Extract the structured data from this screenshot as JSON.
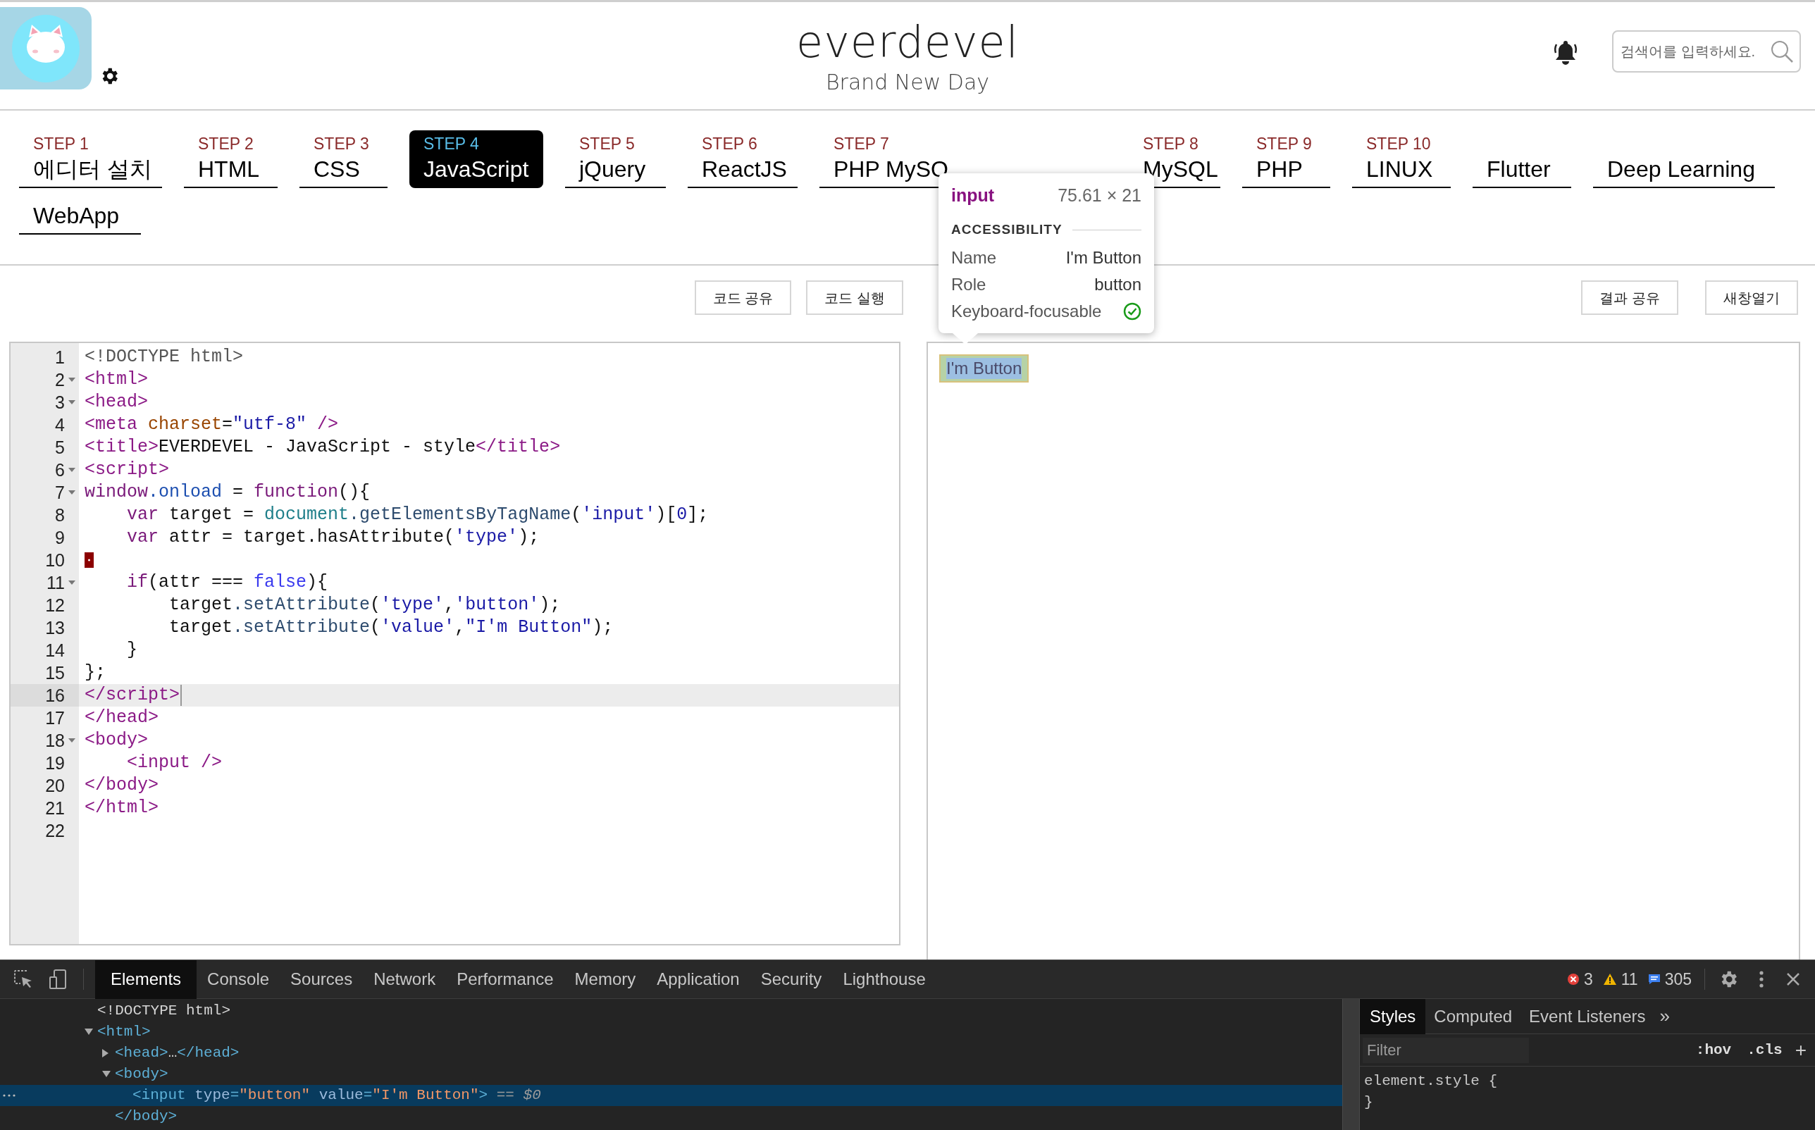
{
  "header": {
    "title": "everdevel",
    "subtitle": "Brand New Day",
    "search": {
      "placeholder": "검색어를 입력하세요."
    }
  },
  "nav": {
    "rows": [
      [
        {
          "step": "STEP 1",
          "label": "에디터 설치",
          "selected": false
        },
        {
          "step": "STEP 2",
          "label": "HTML",
          "selected": false
        },
        {
          "step": "STEP 3",
          "label": "CSS",
          "selected": false
        },
        {
          "step": "STEP 4",
          "label": "JavaScript",
          "selected": true
        },
        {
          "step": "STEP 5",
          "label": "jQuery",
          "selected": false
        },
        {
          "step": "STEP 6",
          "label": "ReactJS",
          "selected": false
        },
        {
          "step": "STEP 7",
          "label": "PHP MySQ",
          "selected": false
        },
        {
          "step": "STEP 8",
          "label": "MySQL",
          "selected": false
        },
        {
          "step": "STEP 9",
          "label": "PHP",
          "selected": false
        },
        {
          "step": "STEP 10",
          "label": "LINUX",
          "selected": false
        },
        {
          "label": "Flutter",
          "selected": false
        },
        {
          "label": "Deep Learning",
          "selected": false
        }
      ],
      [
        {
          "label": "WebApp",
          "selected": false
        }
      ]
    ]
  },
  "editor_buttons": [
    "코드 공유",
    "코드 실행"
  ],
  "result_buttons": [
    "결과 공유",
    "새창열기"
  ],
  "code_lines": [
    {
      "number": "1",
      "fold": false,
      "marked": false,
      "current": false,
      "tokens": [
        {
          "kind": "meta",
          "text": "<!DOCTYPE html>"
        }
      ]
    },
    {
      "number": "2",
      "fold": true,
      "marked": false,
      "current": false,
      "tokens": [
        {
          "kind": "tag",
          "text": "<html>"
        }
      ]
    },
    {
      "number": "3",
      "fold": true,
      "marked": false,
      "current": false,
      "tokens": [
        {
          "kind": "tag",
          "text": "<head>"
        }
      ]
    },
    {
      "number": "4",
      "fold": false,
      "marked": false,
      "current": false,
      "tokens": [
        {
          "kind": "tag",
          "text": "<meta "
        },
        {
          "kind": "attr",
          "text": "charset"
        },
        {
          "kind": "plain",
          "text": "="
        },
        {
          "kind": "string",
          "text": "\"utf-8\""
        },
        {
          "kind": "tag",
          "text": " />"
        }
      ]
    },
    {
      "number": "5",
      "fold": false,
      "marked": false,
      "current": false,
      "tokens": [
        {
          "kind": "tag",
          "text": "<title>"
        },
        {
          "kind": "plain",
          "text": "EVERDEVEL - JavaScript - style"
        },
        {
          "kind": "tag",
          "text": "</title>"
        }
      ]
    },
    {
      "number": "6",
      "fold": true,
      "marked": false,
      "current": false,
      "tokens": [
        {
          "kind": "tag",
          "text": "<script>"
        }
      ]
    },
    {
      "number": "7",
      "fold": true,
      "marked": false,
      "current": false,
      "tokens": [
        {
          "kind": "keyword",
          "text": "window"
        },
        {
          "kind": "property",
          "text": ".onload"
        },
        {
          "kind": "plain",
          "text": " = "
        },
        {
          "kind": "keyword",
          "text": "function"
        },
        {
          "kind": "plain",
          "text": "(){"
        }
      ]
    },
    {
      "number": "8",
      "fold": false,
      "marked": false,
      "current": false,
      "tokens": [
        {
          "kind": "keyword",
          "text": "    var"
        },
        {
          "kind": "plain",
          "text": " target = "
        },
        {
          "kind": "builtin",
          "text": "document"
        },
        {
          "kind": "method",
          "text": ".getElementsByTagName"
        },
        {
          "kind": "plain",
          "text": "("
        },
        {
          "kind": "string",
          "text": "'input'"
        },
        {
          "kind": "plain",
          "text": ")["
        },
        {
          "kind": "number",
          "text": "0"
        },
        {
          "kind": "plain",
          "text": "];"
        }
      ]
    },
    {
      "number": "9",
      "fold": false,
      "marked": false,
      "current": false,
      "tokens": [
        {
          "kind": "keyword",
          "text": "    var"
        },
        {
          "kind": "plain",
          "text": " attr = target.hasAttribute("
        },
        {
          "kind": "string",
          "text": "'type'"
        },
        {
          "kind": "plain",
          "text": ");"
        }
      ]
    },
    {
      "number": "10",
      "fold": false,
      "marked": true,
      "current": false
    },
    {
      "number": "11",
      "fold": true,
      "marked": false,
      "current": false,
      "tokens": [
        {
          "kind": "keyword",
          "text": "    if"
        },
        {
          "kind": "plain",
          "text": "(attr === "
        },
        {
          "kind": "atom",
          "text": "false"
        },
        {
          "kind": "plain",
          "text": "){"
        }
      ]
    },
    {
      "number": "12",
      "fold": false,
      "marked": false,
      "current": false,
      "tokens": [
        {
          "kind": "plain",
          "text": "        target"
        },
        {
          "kind": "method",
          "text": ".setAttribute"
        },
        {
          "kind": "plain",
          "text": "("
        },
        {
          "kind": "string",
          "text": "'type'"
        },
        {
          "kind": "plain",
          "text": ","
        },
        {
          "kind": "string",
          "text": "'button'"
        },
        {
          "kind": "plain",
          "text": ");"
        }
      ]
    },
    {
      "number": "13",
      "fold": false,
      "marked": false,
      "current": false,
      "tokens": [
        {
          "kind": "plain",
          "text": "        target"
        },
        {
          "kind": "method",
          "text": ".setAttribute"
        },
        {
          "kind": "plain",
          "text": "("
        },
        {
          "kind": "string",
          "text": "'value'"
        },
        {
          "kind": "plain",
          "text": ","
        },
        {
          "kind": "string",
          "text": "\"I'm Button\""
        },
        {
          "kind": "plain",
          "text": ");"
        }
      ]
    },
    {
      "number": "14",
      "fold": false,
      "marked": false,
      "current": false,
      "tokens": [
        {
          "kind": "plain",
          "text": "    }"
        }
      ]
    },
    {
      "number": "15",
      "fold": false,
      "marked": false,
      "current": false,
      "tokens": [
        {
          "kind": "plain",
          "text": "};"
        }
      ]
    },
    {
      "number": "16",
      "fold": false,
      "marked": false,
      "current": true,
      "tokens": [
        {
          "kind": "tag",
          "text": "</script>"
        }
      ]
    },
    {
      "number": "17",
      "fold": false,
      "marked": false,
      "current": false,
      "tokens": [
        {
          "kind": "tag",
          "text": "</head>"
        }
      ]
    },
    {
      "number": "18",
      "fold": true,
      "marked": false,
      "current": false,
      "tokens": [
        {
          "kind": "tag",
          "text": "<body>"
        }
      ]
    },
    {
      "number": "19",
      "fold": false,
      "marked": false,
      "current": false,
      "tokens": [
        {
          "kind": "tag",
          "text": "    <input />"
        }
      ]
    },
    {
      "number": "20",
      "fold": false,
      "marked": false,
      "current": false,
      "tokens": [
        {
          "kind": "tag",
          "text": "</body>"
        }
      ]
    },
    {
      "number": "21",
      "fold": false,
      "marked": false,
      "current": false,
      "tokens": [
        {
          "kind": "tag",
          "text": "</html>"
        }
      ]
    },
    {
      "number": "22",
      "fold": false,
      "marked": false,
      "current": false
    }
  ],
  "result": {
    "button_value": "I'm Button",
    "highlighted": true
  },
  "tooltip": {
    "tag": "input",
    "size": "75.61 × 21",
    "section": "ACCESSIBILITY",
    "rows": [
      {
        "kind": "text",
        "label": "Name",
        "value": "I'm Button"
      },
      {
        "kind": "text",
        "label": "Role",
        "value": "button"
      },
      {
        "kind": "check",
        "label": "Keyboard-focusable",
        "checked": true
      }
    ]
  },
  "devtools": {
    "tabs": [
      {
        "label": "Elements",
        "selected": true
      },
      {
        "label": "Console",
        "selected": false
      },
      {
        "label": "Sources",
        "selected": false
      },
      {
        "label": "Network",
        "selected": false
      },
      {
        "label": "Performance",
        "selected": false
      },
      {
        "label": "Memory",
        "selected": false
      },
      {
        "label": "Application",
        "selected": false
      },
      {
        "label": "Security",
        "selected": false
      },
      {
        "label": "Lighthouse",
        "selected": false
      }
    ],
    "counts": {
      "errors": "3",
      "warnings": "11",
      "info": "305"
    },
    "tree": [
      {
        "selected": false,
        "tokens": [
          {
            "kind": "text",
            "text": "<!DOCTYPE html>"
          }
        ]
      },
      {
        "expanded": true,
        "selected": false,
        "tokens": [
          {
            "kind": "tag",
            "text": "<html>"
          }
        ],
        "children": [
          {
            "expanded": false,
            "selected": false,
            "tokens": [
              {
                "kind": "tag",
                "text": "<head>"
              },
              {
                "kind": "text",
                "text": "…"
              },
              {
                "kind": "tag",
                "text": "</head>"
              }
            ]
          },
          {
            "expanded": true,
            "selected": false,
            "tokens": [
              {
                "kind": "tag",
                "text": "<body>"
              }
            ],
            "closing": "</body>",
            "children": [
              {
                "selected": true,
                "tokens": [
                  {
                    "kind": "tag",
                    "text": "<input "
                  },
                  {
                    "kind": "attr",
                    "text": "type"
                  },
                  {
                    "kind": "tag",
                    "text": "="
                  },
                  {
                    "kind": "value",
                    "text": "\"button\""
                  },
                  {
                    "kind": "attr",
                    "text": " value"
                  },
                  {
                    "kind": "tag",
                    "text": "="
                  },
                  {
                    "kind": "value",
                    "text": "\"I'm Button\""
                  },
                  {
                    "kind": "tag",
                    "text": ">"
                  },
                  {
                    "kind": "marker",
                    "text": " == $0"
                  }
                ]
              }
            ]
          }
        ]
      }
    ],
    "styles": {
      "tabs": [
        {
          "label": "Styles",
          "selected": true
        },
        {
          "label": "Computed",
          "selected": false
        },
        {
          "label": "Event Listeners",
          "selected": false
        }
      ],
      "more": "»",
      "filter": {
        "placeholder": "Filter"
      },
      "hov": ":hov",
      "cls": ".cls",
      "add": "+",
      "rule": [
        "element.style {",
        "}"
      ]
    }
  }
}
